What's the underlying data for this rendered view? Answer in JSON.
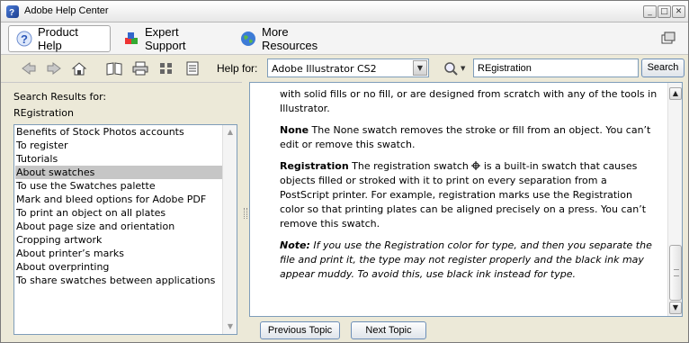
{
  "window": {
    "title": "Adobe Help Center",
    "controls": {
      "minimize": "_",
      "maximize": "□",
      "close": "✕"
    }
  },
  "tabs": [
    {
      "label": "Product Help",
      "icon": "help-question-icon",
      "active": true
    },
    {
      "label": "Expert Support",
      "icon": "support-cubes-icon",
      "active": false
    },
    {
      "label": "More Resources",
      "icon": "globe-icon",
      "active": false
    }
  ],
  "toolbar": {
    "help_for_label": "Help for:",
    "product_selected": "Adobe Illustrator CS2",
    "search_value": "REgistration",
    "search_button": "Search"
  },
  "left_panel": {
    "results_label": "Search Results for:",
    "query": "REgistration",
    "results": [
      "Benefits of Stock Photos accounts",
      "To register",
      "Tutorials",
      "About swatches",
      "To use the Swatches palette",
      "Mark and bleed options for Adobe PDF",
      "To print an object on all plates",
      "About page size and orientation",
      "Cropping artwork",
      "About printer’s marks",
      "About overprinting",
      "To share swatches between applications"
    ],
    "selected_index": 3
  },
  "content": {
    "p1": "with solid fills or no fill, or are designed from scratch with any of the tools in Illustrator.",
    "none_term": "None",
    "none_text": " The None swatch removes the stroke or fill from an object. You can’t edit or remove this swatch.",
    "reg_term": "Registration",
    "reg_text_1": " The registration swatch ",
    "reg_text_2": " is a built-in swatch that causes objects filled or stroked with it to print on every separation from a PostScript printer. For example, registration marks use the Registration color so that printing plates can be aligned precisely on a press. You can’t remove this swatch.",
    "note_label": "Note:",
    "note_text": " If you use the Registration color for type, and then you separate the file and print it, the type may not register properly and the black ink may appear muddy. To avoid this, use black ink instead for type."
  },
  "nav": {
    "previous": "Previous Topic",
    "next": "Next Topic"
  }
}
